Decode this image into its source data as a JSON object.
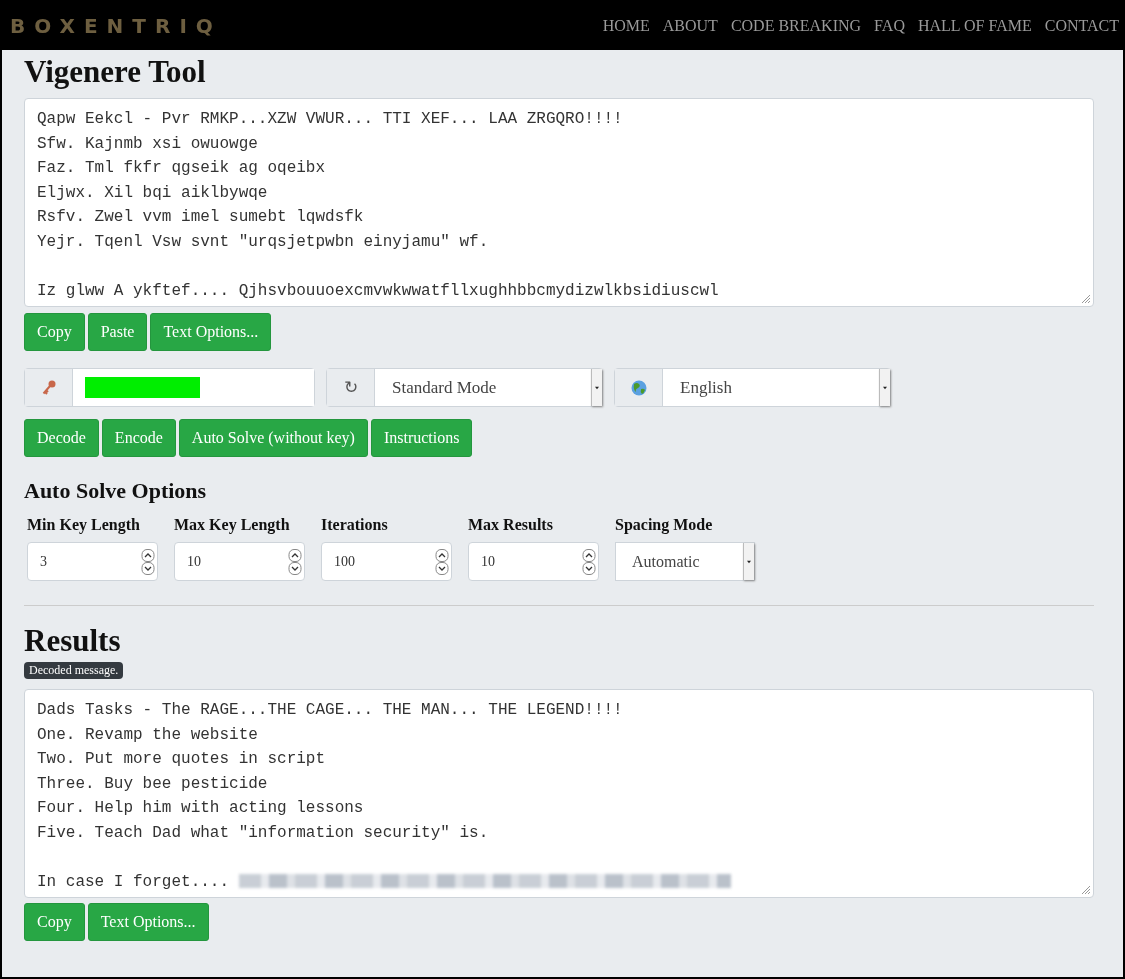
{
  "header": {
    "logo": "BOXENTRIQ",
    "nav": [
      {
        "label": "HOME"
      },
      {
        "label": "ABOUT"
      },
      {
        "label": "CODE BREAKING"
      },
      {
        "label": "FAQ"
      },
      {
        "label": "HALL OF FAME"
      },
      {
        "label": "CONTACT"
      }
    ]
  },
  "title": "Vigenere Tool",
  "input_text": {
    "paragraphs": [
      [
        "Qapw Eekcl - Pvr RMKP...XZW VWUR... TTI XEF... LAA ZRGQRO!!!!",
        "Sfw. Kajnmb xsi owuowge",
        "Faz. Tml fkfr qgseik ag oqeibx",
        "Eljwx. Xil bqi aiklbywqe",
        "Rsfv. Zwel vvm imel sumebt lqwdsfk",
        "Yejr. Tqenl Vsw svnt \"urqsjetpwbn einyjamu\" wf."
      ],
      [
        "Iz glww A ykftef.... Qjhsvbouuoexcmvwkwwatfllxughhbbcmydizwlkbsidiuscwl"
      ]
    ]
  },
  "input_buttons": [
    "Copy",
    "Paste",
    "Text Options..."
  ],
  "key_row": {
    "key_redacted": true,
    "mode_icon": "↻",
    "mode": "Standard Mode",
    "language": "English"
  },
  "action_buttons": [
    "Decode",
    "Encode",
    "Auto Solve (without key)",
    "Instructions"
  ],
  "auto_solve": {
    "heading": "Auto Solve Options",
    "fields": [
      {
        "label": "Min Key Length",
        "value": "3",
        "kind": "number"
      },
      {
        "label": "Max Key Length",
        "value": "10",
        "kind": "number"
      },
      {
        "label": "Iterations",
        "value": "100",
        "kind": "number"
      },
      {
        "label": "Max Results",
        "value": "10",
        "kind": "number"
      },
      {
        "label": "Spacing Mode",
        "value": "Automatic",
        "kind": "select"
      }
    ]
  },
  "results": {
    "heading": "Results",
    "badge": "Decoded message.",
    "text": {
      "paragraphs": [
        [
          "Dads Tasks - The RAGE...THE CAGE... THE MAN... THE LEGEND!!!!",
          "One. Revamp the website",
          "Two. Put more quotes in script",
          "Three. Buy bee pesticide",
          "Four. Help him with acting lessons",
          "Five. Teach Dad what \"information security\" is."
        ],
        [
          "In case I forget...."
        ]
      ],
      "blurred_tail": true
    },
    "buttons": [
      "Copy",
      "Text Options..."
    ]
  }
}
